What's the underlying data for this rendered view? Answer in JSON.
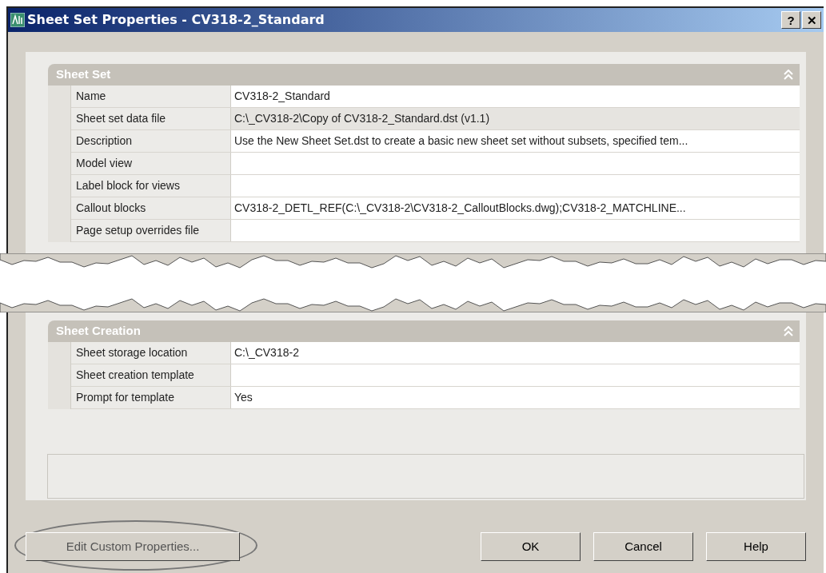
{
  "window": {
    "title": "Sheet Set Properties - CV318-2_Standard",
    "title_buttons": [
      "?",
      "✕"
    ]
  },
  "sections": [
    {
      "title": "Sheet Set",
      "expanded": true,
      "rows": [
        {
          "label": "Name",
          "value": "CV318-2_Standard",
          "selected": false
        },
        {
          "label": "Sheet set data file",
          "value": "C:\\_CV318-2\\Copy of CV318-2_Standard.dst (v1.1)",
          "selected": true
        },
        {
          "label": "Description",
          "value": "Use the New Sheet Set.dst to create a basic new sheet set without subsets, specified tem...",
          "selected": false
        },
        {
          "label": "Model view",
          "selected": false
        },
        {
          "label": "Label block for views",
          "selected": false
        },
        {
          "label": "Callout blocks",
          "value": "CV318-2_DETL_REF(C:\\_CV318-2\\CV318-2_CalloutBlocks.dwg);CV318-2_MATCHLINE...",
          "selected": false
        },
        {
          "label": "Page setup overrides file",
          "selected": false
        }
      ]
    },
    {
      "title": "Sheet Creation",
      "expanded": true,
      "rows": [
        {
          "label": "Sheet storage location",
          "value": "C:\\_CV318-2",
          "selected": false
        },
        {
          "label": "Sheet creation template",
          "selected": false
        },
        {
          "label": "Prompt for template",
          "value": "Yes",
          "selected": false
        }
      ]
    }
  ],
  "buttons": [
    {
      "label": "Edit Custom Properties...",
      "disabled": true,
      "circled": true
    },
    {
      "label": "OK",
      "disabled": false,
      "circled": false
    },
    {
      "label": "Cancel",
      "disabled": false,
      "circled": false
    },
    {
      "label": "Help",
      "disabled": false,
      "circled": false
    }
  ]
}
